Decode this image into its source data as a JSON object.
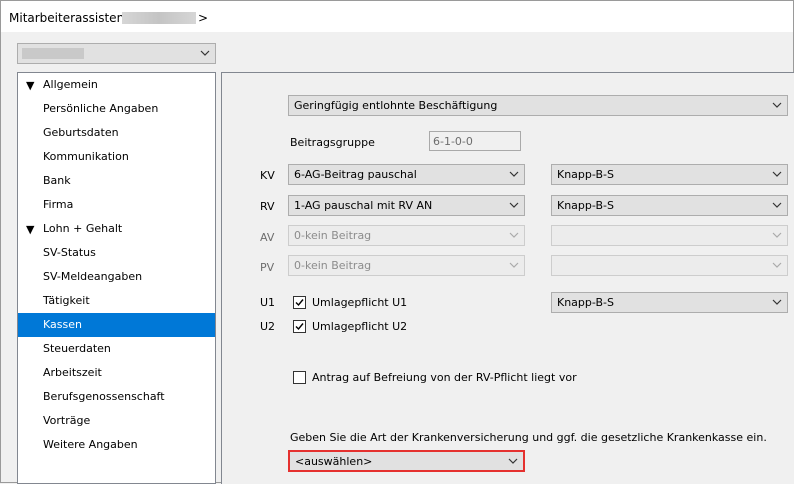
{
  "window": {
    "title": "Mitarbeiterassistent <",
    "title_end": ">"
  },
  "nav": {
    "items": [
      {
        "label": "Allgemein",
        "group": true
      },
      {
        "label": "Persönliche Angaben"
      },
      {
        "label": "Geburtsdaten"
      },
      {
        "label": "Kommunikation"
      },
      {
        "label": "Bank"
      },
      {
        "label": "Firma"
      },
      {
        "label": "Lohn + Gehalt",
        "group": true
      },
      {
        "label": "SV-Status"
      },
      {
        "label": "SV-Meldeangaben"
      },
      {
        "label": "Tätigkeit"
      },
      {
        "label": "Kassen",
        "selected": true
      },
      {
        "label": "Steuerdaten"
      },
      {
        "label": "Arbeitszeit"
      },
      {
        "label": "Berufsgenossenschaft"
      },
      {
        "label": "Vorträge"
      },
      {
        "label": "Weitere Angaben"
      }
    ]
  },
  "kassen": {
    "beschaeftigung": "Geringfügig entlohnte Beschäftigung",
    "beitragsgruppe_label": "Beitragsgruppe",
    "beitragsgruppe_value": "6-1-0-0",
    "rows": {
      "kv": {
        "label": "KV",
        "beitrag": "6-AG-Beitrag pauschal",
        "kasse": "Knapp-B-S"
      },
      "rv": {
        "label": "RV",
        "beitrag": "1-AG pauschal mit RV AN",
        "kasse": "Knapp-B-S"
      },
      "av": {
        "label": "AV",
        "beitrag": "0-kein Beitrag",
        "kasse": ""
      },
      "pv": {
        "label": "PV",
        "beitrag": "0-kein Beitrag",
        "kasse": ""
      }
    },
    "u1": {
      "label": "U1",
      "checkbox_label": "Umlagepflicht U1",
      "checked": true,
      "kasse": "Knapp-B-S"
    },
    "u2": {
      "label": "U2",
      "checkbox_label": "Umlagepflicht U2",
      "checked": true
    },
    "rv_befreiung": {
      "label": "Antrag auf Befreiung von der RV-Pflicht liegt vor",
      "checked": false
    },
    "hint": "Geben Sie die Art der Krankenversicherung und ggf. die gesetzliche Krankenkasse ein.",
    "kv_art_select": "<auswählen>"
  },
  "colors": {
    "selection": "#0078d7",
    "highlight_border": "#e5312f"
  }
}
